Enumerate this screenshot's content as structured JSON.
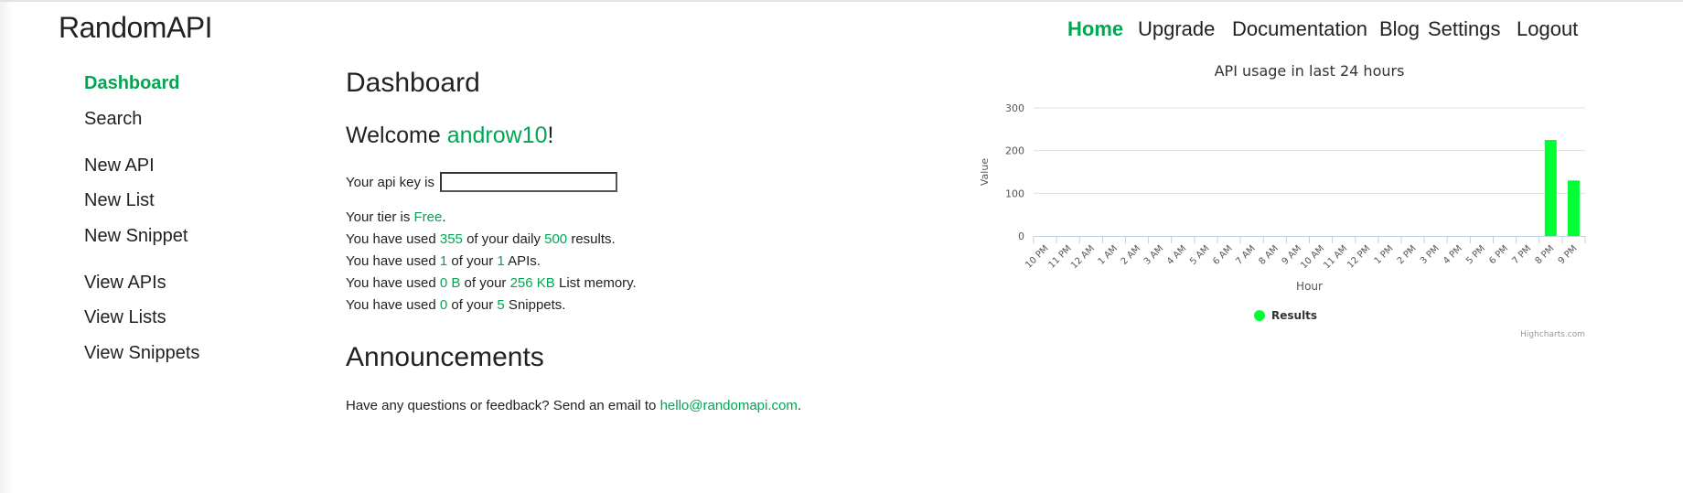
{
  "header": {
    "logo": "RandomAPI",
    "nav": [
      {
        "label": "Home",
        "active": true
      },
      {
        "label": "Upgrade"
      },
      {
        "label": "Documentation"
      },
      {
        "label": "Blog"
      },
      {
        "label": "Settings"
      },
      {
        "label": "Logout"
      }
    ]
  },
  "sidebar": {
    "items": [
      {
        "label": "Dashboard",
        "active": true
      },
      {
        "label": "Search"
      },
      {
        "label": "New API"
      },
      {
        "label": "New List"
      },
      {
        "label": "New Snippet"
      },
      {
        "label": "View APIs"
      },
      {
        "label": "View Lists"
      },
      {
        "label": "View Snippets"
      }
    ]
  },
  "main": {
    "title": "Dashboard",
    "welcome": {
      "prefix": "Welcome ",
      "username": "androw10",
      "suffix": "!"
    },
    "api_key": {
      "label": "Your api key is",
      "value": ""
    },
    "tier": {
      "prefix": "Your tier is ",
      "value": "Free",
      "suffix": "."
    },
    "results": {
      "p1": "You have used ",
      "used": "355",
      "p2": " of your daily ",
      "limit": "500",
      "p3": " results."
    },
    "apis": {
      "p1": "You have used ",
      "used": "1",
      "p2": " of your ",
      "limit": "1",
      "p3": " APIs."
    },
    "memory": {
      "p1": "You have used ",
      "used": "0 B",
      "p2": " of your ",
      "limit": "256 KB",
      "p3": " List memory."
    },
    "snippets": {
      "p1": "You have used ",
      "used": "0",
      "p2": " of your ",
      "limit": "5",
      "p3": " Snippets."
    },
    "announcements": {
      "title": "Announcements",
      "text": "Have any questions or feedback? Send an email to ",
      "email": "hello@randomapi.com",
      "suffix": "."
    }
  },
  "colors": {
    "accent": "#00a651",
    "bar": "#00ff33"
  },
  "chart_data": {
    "type": "bar",
    "title": "API usage in last 24 hours",
    "xlabel": "Hour",
    "ylabel": "Value",
    "categories": [
      "10 PM",
      "11 PM",
      "12 AM",
      "1 AM",
      "2 AM",
      "3 AM",
      "4 AM",
      "5 AM",
      "6 AM",
      "7 AM",
      "8 AM",
      "9 AM",
      "10 AM",
      "11 AM",
      "12 PM",
      "1 PM",
      "2 PM",
      "3 PM",
      "4 PM",
      "5 PM",
      "6 PM",
      "7 PM",
      "8 PM",
      "9 PM"
    ],
    "series": [
      {
        "name": "Results",
        "values": [
          0,
          0,
          0,
          0,
          0,
          0,
          0,
          0,
          0,
          0,
          0,
          0,
          0,
          0,
          0,
          0,
          0,
          0,
          0,
          0,
          0,
          0,
          225,
          130
        ]
      }
    ],
    "ylim": [
      0,
      300
    ],
    "yticks": [
      0,
      100,
      200,
      300
    ],
    "grid": true,
    "legend": "bottom-center",
    "credits": "Highcharts.com"
  }
}
